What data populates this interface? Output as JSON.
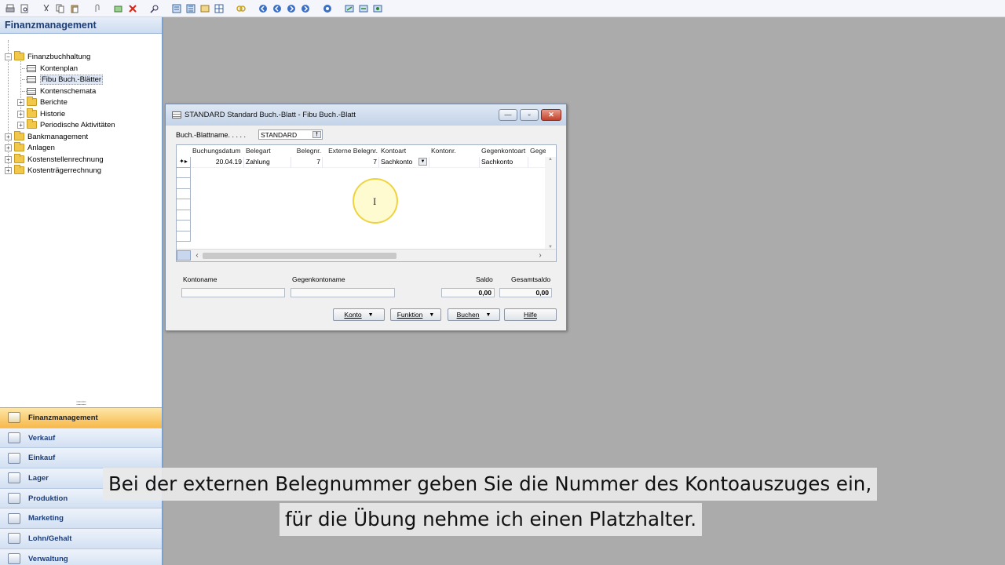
{
  "toolbar": {
    "icons": [
      "print-icon",
      "preview-icon",
      "cut-icon",
      "copy-icon",
      "paste-icon",
      "attach-icon",
      "find-icon",
      "delete-icon",
      "search-icon",
      "view-icon",
      "list-icon",
      "card-icon",
      "table-icon",
      "link-icon",
      "first-icon",
      "prev-icon",
      "next-icon",
      "last-icon",
      "go-icon",
      "export-icon",
      "refresh-icon",
      "settings-icon"
    ]
  },
  "nav": {
    "title": "Finanzmanagement",
    "tree": [
      {
        "label": "Finanzbuchhaltung"
      },
      {
        "label": "Kontenplan"
      },
      {
        "label": "Fibu Buch.-Blätter"
      },
      {
        "label": "Kontenschemata"
      },
      {
        "label": "Berichte"
      },
      {
        "label": "Historie"
      },
      {
        "label": "Periodische Aktivitäten"
      },
      {
        "label": "Bankmanagement"
      },
      {
        "label": "Anlagen"
      },
      {
        "label": "Kostenstellenrechnung"
      },
      {
        "label": "Kostenträgerrechnung"
      }
    ],
    "splitter": "::::::::::",
    "modules": [
      {
        "label": "Finanzmanagement"
      },
      {
        "label": "Verkauf"
      },
      {
        "label": "Einkauf"
      },
      {
        "label": "Lager"
      },
      {
        "label": "Produktion"
      },
      {
        "label": "Marketing"
      },
      {
        "label": "Lohn/Gehalt"
      },
      {
        "label": "Verwaltung"
      }
    ]
  },
  "dialog": {
    "title": "STANDARD Standard Buch.-Blatt - Fibu Buch.-Blatt",
    "min": "—",
    "max": "▫",
    "close": "✕",
    "name_label": "Buch.-Blattname. . . . .",
    "name_value": "STANDARD",
    "lookup": "🠕",
    "columns": [
      "Buchungsdatum",
      "Belegart",
      "Belegnr.",
      "Externe Belegnr.",
      "Kontoart",
      "Kontonr.",
      "Gegenkontoart",
      "Gege"
    ],
    "rows": [
      {
        "marker": "✦▸",
        "date": "20.04.19",
        "belegart": "Zahlung",
        "belegnr": "7",
        "extern": "7",
        "kontoart": "Sachkonto",
        "kontonr": "",
        "gegenkontoart": "Sachkonto",
        "gege": ""
      }
    ],
    "dropdown_glyph": "▼",
    "scroll_up": "▲",
    "scroll_down": "▼",
    "scroll_left": "‹",
    "scroll_right": "›",
    "cursor": "I",
    "footer": {
      "kontoname_label": "Kontoname",
      "gegenkontoname_label": "Gegenkontoname",
      "saldo_label": "Saldo",
      "gesamtsaldo_label": "Gesamtsaldo",
      "saldo_value": "0,00",
      "gesamtsaldo_value": "0,00"
    },
    "buttons": {
      "konto": "Konto",
      "funktion": "Funktion",
      "buchen": "Buchen",
      "hilfe": "Hilfe",
      "arrow": "▼"
    }
  },
  "subtitles": [
    "Bei der externen Belegnummer geben Sie die Nummer des Kontoauszuges ein,",
    "für die Übung nehme ich einen Platzhalter."
  ]
}
